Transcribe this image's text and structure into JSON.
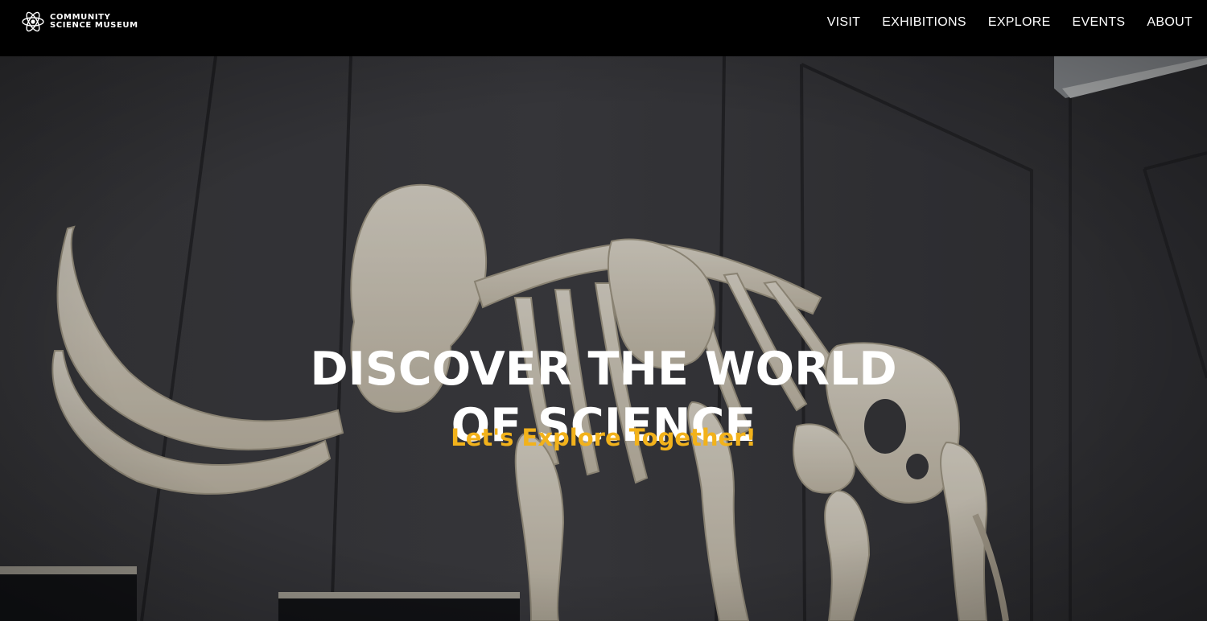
{
  "header": {
    "logo": {
      "line1": "COMMUNITY",
      "line2": "SCIENCE MUSEUM",
      "icon": "atom-icon"
    },
    "nav": [
      {
        "label": "VISIT"
      },
      {
        "label": "EXHIBITIONS"
      },
      {
        "label": "EXPLORE"
      },
      {
        "label": "EVENTS"
      },
      {
        "label": "ABOUT"
      }
    ]
  },
  "hero": {
    "title_line1": "DISCOVER THE WORLD",
    "title_line2": "OF SCIENCE",
    "subtitle": "Let's Explore Together!",
    "background_image": "mammoth-skeleton-photo"
  },
  "colors": {
    "header_bg": "#000000",
    "accent": "#f2b21b",
    "text": "#ffffff",
    "wall": "#38383c"
  }
}
